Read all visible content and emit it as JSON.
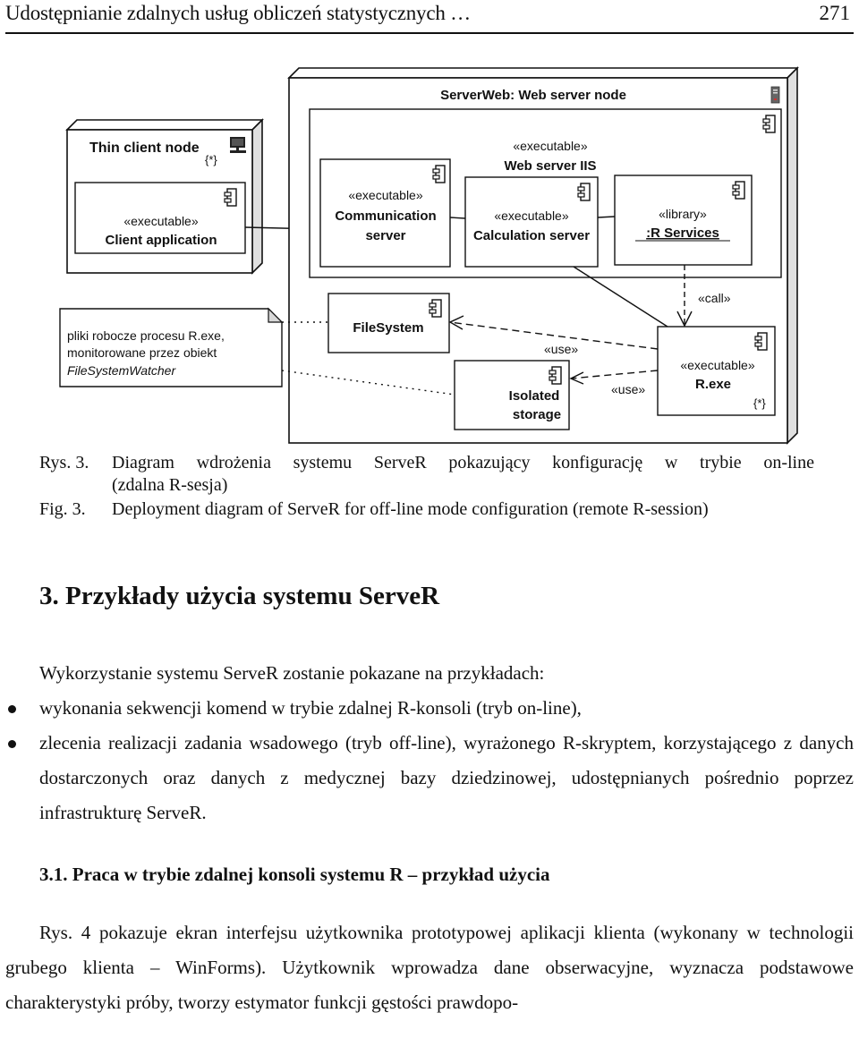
{
  "header": {
    "running_title": "Udostępnianie zdalnych usług obliczeń statystycznych …",
    "page_number": "271"
  },
  "diagram": {
    "thin_client_node": {
      "title": "Thin client node",
      "multiplicity": "{*}",
      "icon": "computer-icon",
      "component": {
        "stereotype": "«executable»",
        "name": "Client application",
        "icon": "component-icon"
      }
    },
    "server_node": {
      "title": "ServerWeb: Web server node",
      "icon": "server-tower-icon",
      "web_server": {
        "stereotype": "«executable»",
        "name": "Web server IIS",
        "icon": "component-icon",
        "components": [
          {
            "stereotype": "«executable»",
            "name_line1": "Communication",
            "name_line2": "server",
            "icon": "component-icon"
          },
          {
            "stereotype": "«executable»",
            "name": "Calculation server",
            "icon": "component-icon"
          },
          {
            "stereotype": "«library»",
            "name": ":R Services",
            "icon": "component-icon"
          }
        ]
      },
      "filesystem": {
        "name": "FileSystem",
        "icon": "component-icon"
      },
      "isolated_storage": {
        "name_line1": "Isolated",
        "name_line2": "storage",
        "icon": "component-icon"
      },
      "r_exe": {
        "stereotype": "«executable»",
        "name": "R.exe",
        "multiplicity": "{*}",
        "icon": "component-icon"
      },
      "relations": {
        "call_label": "«call»",
        "use_label_filesystem": "«use»",
        "use_label_isolated": "«use»"
      }
    },
    "note": {
      "line1": "pliki  robocze procesu R.exe,",
      "line2": "monitorowane przez obiekt",
      "line3": "FileSystemWatcher"
    }
  },
  "captions": {
    "pl_label": "Rys. 3.",
    "pl_line1": "Diagram wdrożenia systemu ServeR pokazujący konfigurację w trybie on-line",
    "pl_line2": "(zdalna R-sesja)",
    "en_label": "Fig. 3.",
    "en_text": "Deployment diagram of ServeR for off-line mode configuration (remote R-session)"
  },
  "section": {
    "heading": "3. Przykłady użycia systemu ServeR",
    "intro": "Wykorzystanie systemu ServeR zostanie pokazane na przykładach:",
    "bullets": [
      "wykonania sekwencji komend w trybie zdalnej R-konsoli (tryb on-line),",
      "zlecenia realizacji zadania wsadowego (tryb off-line), wyrażonego R-skryptem, korzystającego z danych dostarczonych oraz danych z medycznej bazy dziedzinowej, udostępnianych pośrednio poprzez infrastrukturę ServeR."
    ]
  },
  "subsection": {
    "heading": "3.1.  Praca w trybie zdalnej konsoli systemu R – przykład użycia",
    "paragraph": "Rys. 4 pokazuje ekran interfejsu użytkownika prototypowej aplikacji klienta (wykonany w technologii grubego klienta – WinForms). Użytkownik wprowadza dane obserwacyjne, wyznacza podstawowe charakterystyki próby, tworzy estymator funkcji gęstości prawdopo-"
  }
}
